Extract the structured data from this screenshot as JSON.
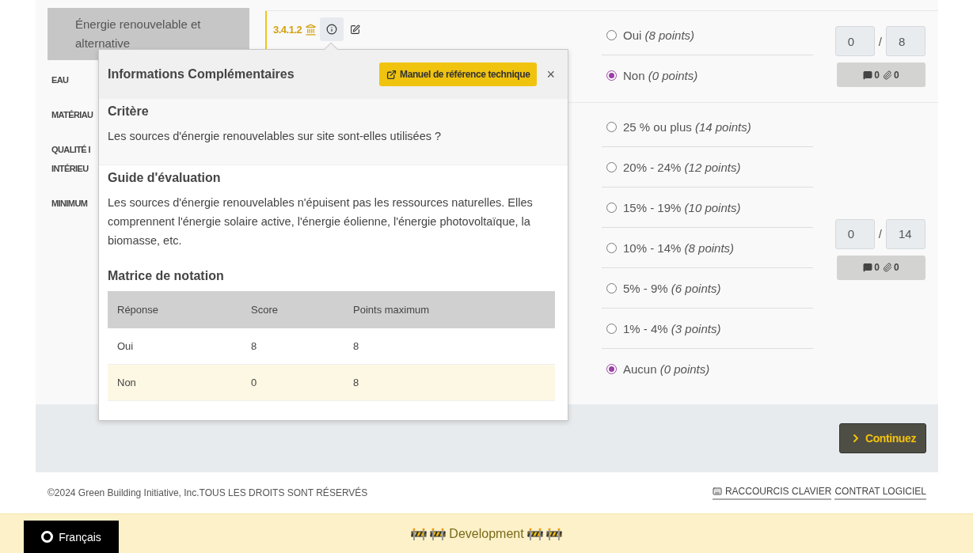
{
  "sidebar": {
    "items": [
      {
        "kind": "sub",
        "label": "Énergie renouvelable et alternative",
        "selected": true
      },
      {
        "kind": "section",
        "label": "EAU",
        "selected": false
      },
      {
        "kind": "section",
        "label": "MATÉRIAU",
        "selected": false
      },
      {
        "kind": "section",
        "label": "QUALITÉ I\nINTÉRIEU",
        "selected": false
      },
      {
        "kind": "section",
        "label": "MINIMUM",
        "selected": false
      }
    ]
  },
  "criteria": [
    {
      "code": "3.4.1.2",
      "answers": [
        {
          "label": "Oui *(8 points)*",
          "selected": false
        },
        {
          "label": "Non *(0 points)*",
          "selected": true
        }
      ],
      "score": "0",
      "max": "8",
      "comments": "0",
      "attachments": "0"
    },
    {
      "answers": [
        {
          "label": "25 % ou plus *(14 points)*",
          "selected": false
        },
        {
          "label": "20% - 24% *(12 points)*",
          "selected": false
        },
        {
          "label": "15% - 19% *(10 points)*",
          "selected": false
        },
        {
          "label": "10% - 14% *(8 points)*",
          "selected": false
        },
        {
          "label": "5% - 9% *(6 points)*",
          "selected": false
        },
        {
          "label": "1% - 4% *(3 points)*",
          "selected": false
        },
        {
          "label": "Aucun *(0 points)*",
          "selected": true
        }
      ],
      "score": "0",
      "max": "14",
      "comments": "0",
      "attachments": "0"
    }
  ],
  "separator": "/",
  "popover": {
    "title": "Informations Complémentaires",
    "manual_button": "Manuel de référence technique",
    "close": "×",
    "critere_title": "Critère",
    "critere_text": "Les sources d'énergie renouvelables sur site sont-elles utilisées ?",
    "guide_title": "Guide d'évaluation",
    "guide_text": "Les sources d'énergie renouvelables n'épuisent pas les ressources naturelles. Elles comprennent l'énergie solaire active, l'énergie éolienne, l'énergie photovoltaïque, la biomasse, etc.",
    "matrix_title": "Matrice de notation",
    "table": {
      "columns": [
        "Réponse",
        "Score",
        "Points maximum"
      ],
      "rows": [
        {
          "cells": [
            "Oui",
            "8",
            "8"
          ],
          "selected": false
        },
        {
          "cells": [
            "Non",
            "0",
            "8"
          ],
          "selected": true
        }
      ]
    }
  },
  "continue_button": "Continuez",
  "footer": {
    "copyright": "©2024 Green Building Initiative, Inc.TOUS LES DROITS SONT RÉSERVÉS",
    "links": [
      "RACCOURCIS CLAVIER",
      "CONTRAT LOGICIEL"
    ]
  },
  "dev_banner": {
    "text": "Development",
    "language": "Français"
  }
}
